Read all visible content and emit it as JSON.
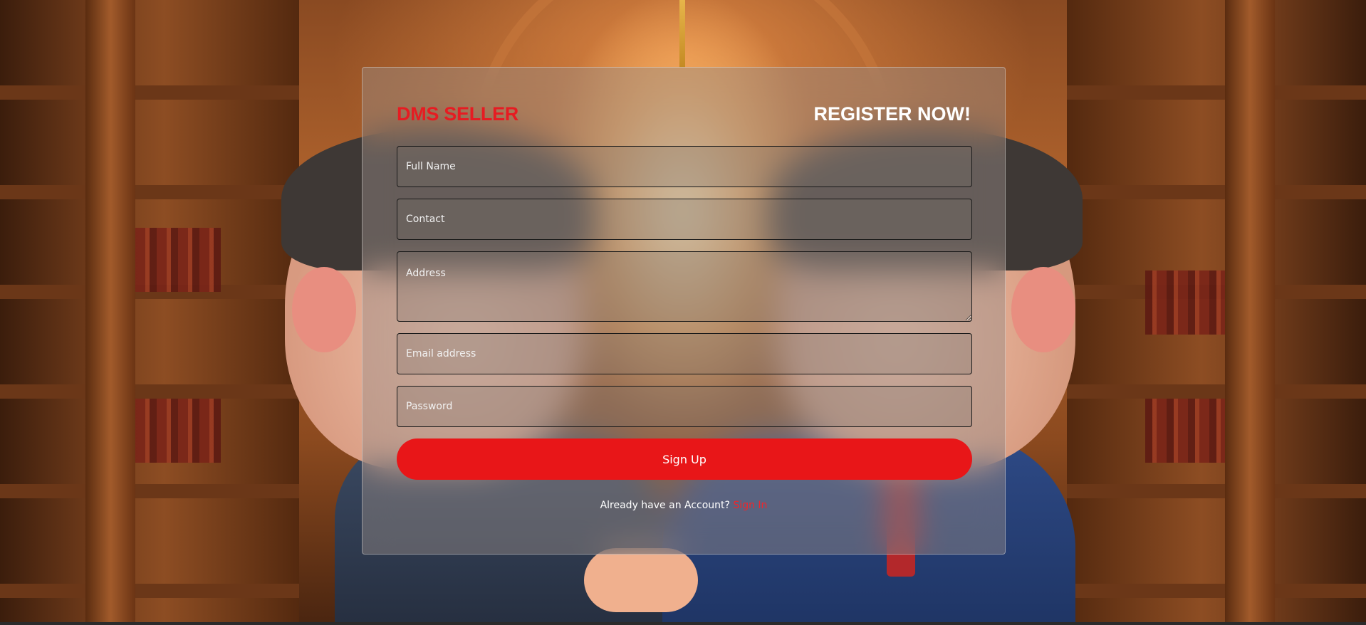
{
  "brand": {
    "name": "DMS SELLER",
    "color": "#e61c22"
  },
  "form": {
    "title": "REGISTER NOW!",
    "fields": {
      "full_name": {
        "placeholder": "Full Name",
        "value": ""
      },
      "contact": {
        "placeholder": "Contact",
        "value": ""
      },
      "address": {
        "placeholder": "Address",
        "value": ""
      },
      "email": {
        "placeholder": "Email address",
        "value": ""
      },
      "password": {
        "placeholder": "Password",
        "value": ""
      }
    },
    "submit_label": "Sign Up",
    "signin_prompt": "Already have an Account?",
    "signin_link": "Sign In"
  },
  "colors": {
    "accent": "#e81618",
    "link": "#f0262b"
  }
}
